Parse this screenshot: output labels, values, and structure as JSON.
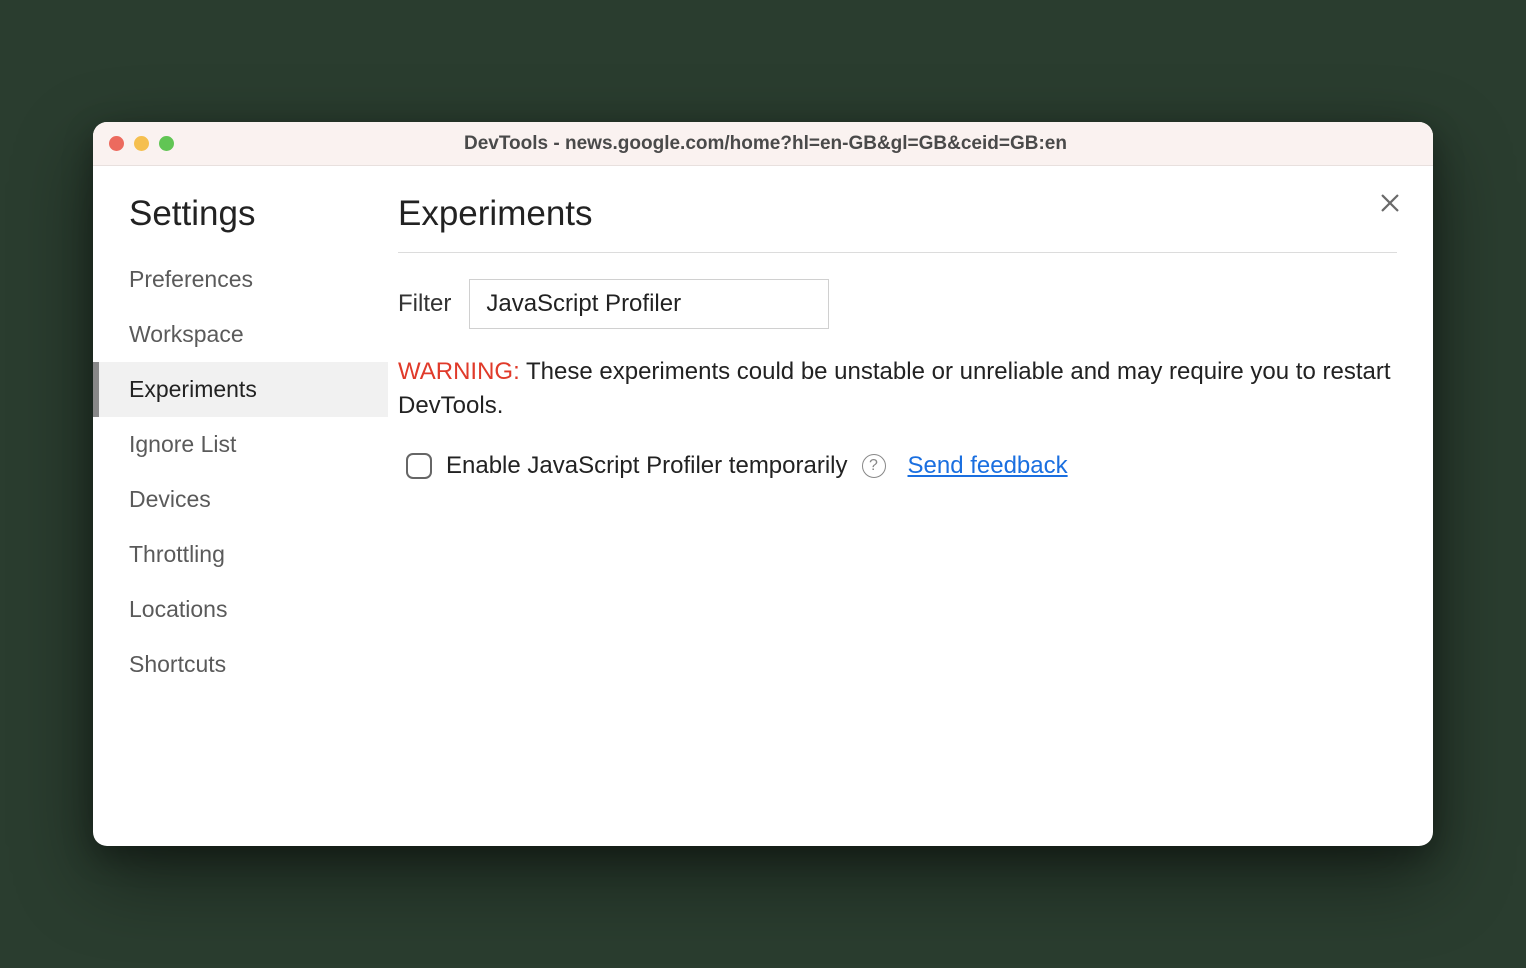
{
  "window": {
    "title": "DevTools - news.google.com/home?hl=en-GB&gl=GB&ceid=GB:en"
  },
  "sidebar": {
    "title": "Settings",
    "items": [
      {
        "label": "Preferences",
        "active": false
      },
      {
        "label": "Workspace",
        "active": false
      },
      {
        "label": "Experiments",
        "active": true
      },
      {
        "label": "Ignore List",
        "active": false
      },
      {
        "label": "Devices",
        "active": false
      },
      {
        "label": "Throttling",
        "active": false
      },
      {
        "label": "Locations",
        "active": false
      },
      {
        "label": "Shortcuts",
        "active": false
      }
    ]
  },
  "main": {
    "title": "Experiments",
    "filter": {
      "label": "Filter",
      "value": "JavaScript Profiler"
    },
    "warning": {
      "prefix": "WARNING:",
      "text": " These experiments could be unstable or unreliable and may require you to restart DevTools."
    },
    "experiment": {
      "label": "Enable JavaScript Profiler temporarily",
      "checked": false,
      "help": "?",
      "feedback": "Send feedback"
    }
  }
}
